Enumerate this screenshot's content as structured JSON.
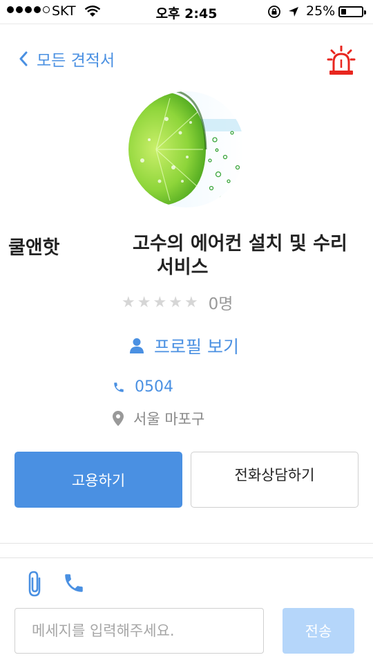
{
  "status_bar": {
    "carrier": "SKT",
    "time": "오후 2:45",
    "battery": "25%",
    "battery_level": 0.25,
    "signal_bars": 4
  },
  "nav": {
    "back_label": "모든 견적서",
    "back_icon": "chevron-left-icon",
    "alarm_icon": "siren-icon"
  },
  "profile": {
    "company_name": "쿨앤핫",
    "service_title_line1": "고수의 에어컨 설치 및 수리",
    "service_title_line2": "서비스",
    "rating_stars": 0,
    "review_count": "0명",
    "profile_link": "프로필 보기",
    "phone": "0504",
    "location": "서울 마포구"
  },
  "actions": {
    "hire_label": "고용하기",
    "consult_label": "전화상담하기"
  },
  "message": {
    "placeholder": "메세지를 입력해주세요.",
    "send_label": "전송"
  },
  "colors": {
    "accent": "#4a90e2",
    "send_disabled": "#b5d6fa",
    "alarm": "#e8261f"
  }
}
